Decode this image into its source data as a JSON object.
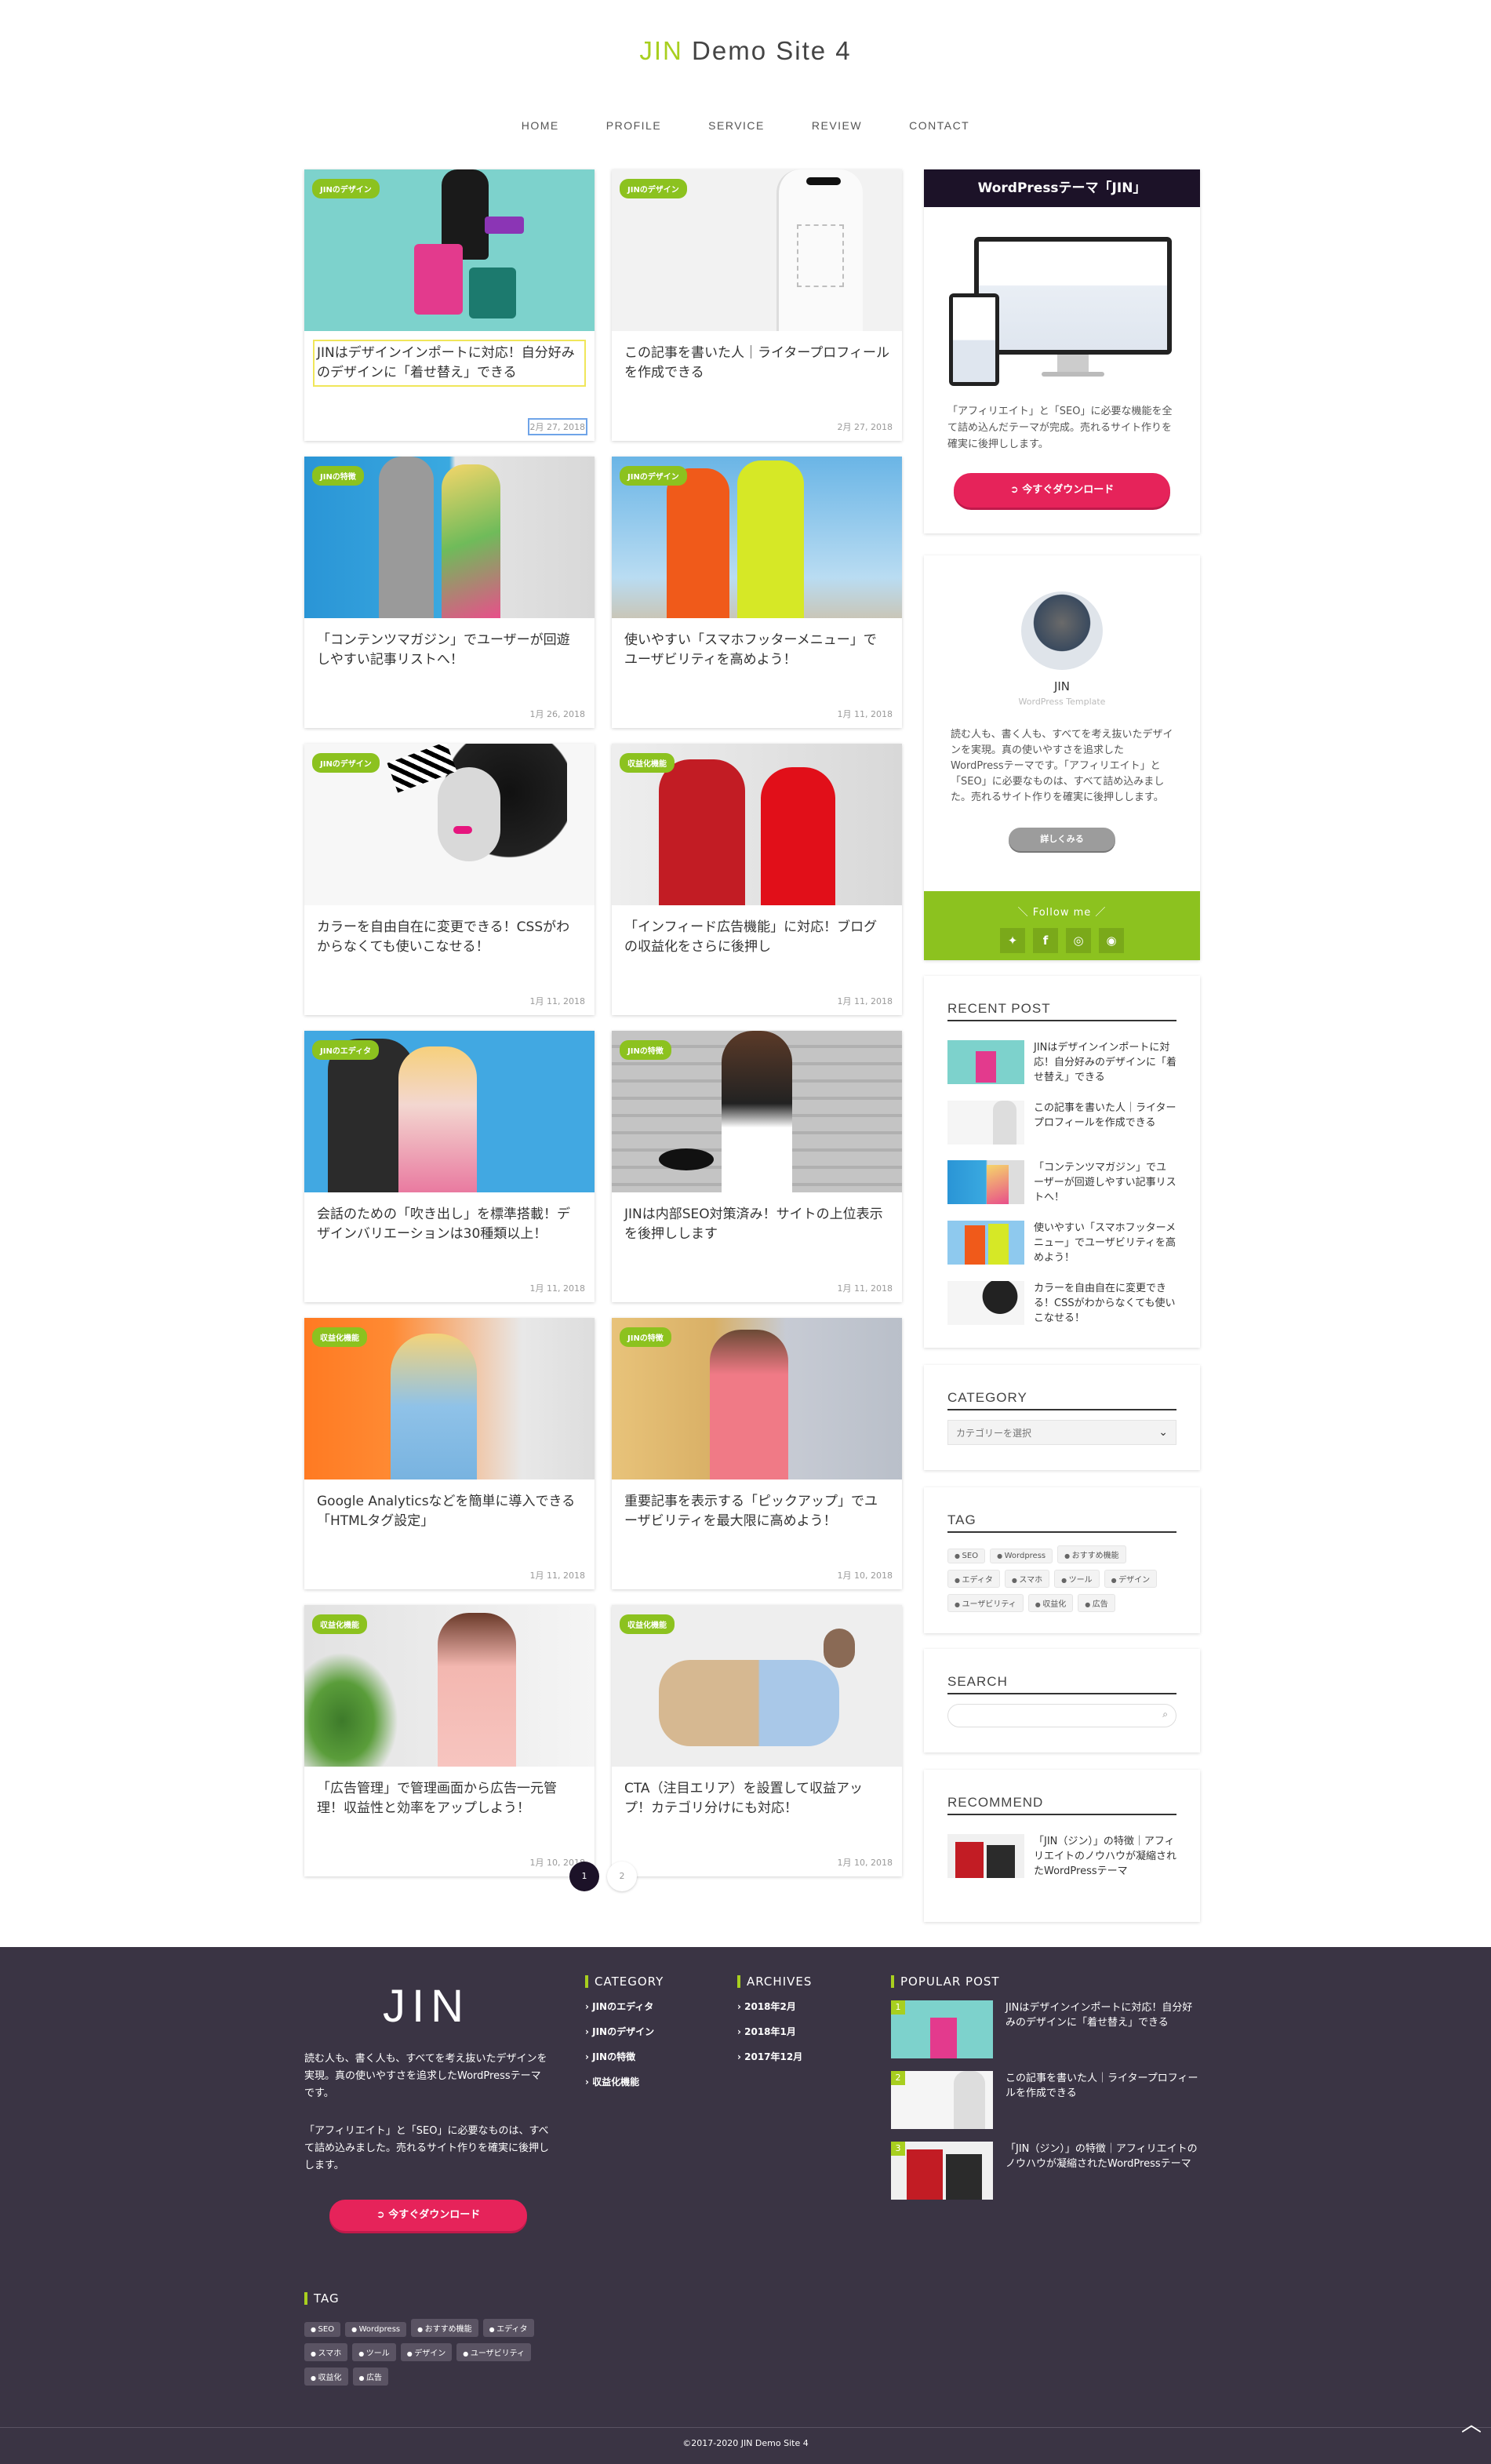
{
  "site": {
    "title_brand": "JIN",
    "title_rest": " Demo Site 4"
  },
  "nav": [
    "HOME",
    "PROFILE",
    "SERVICE",
    "REVIEW",
    "CONTACT"
  ],
  "posts": [
    {
      "category": "JINのデザイン",
      "title": "JINはデザインインポートに対応！自分好みのデザインに「着せ替え」できる",
      "date": "2月 27, 2018"
    },
    {
      "category": "JINのデザイン",
      "title": "この記事を書いた人｜ライタープロフィールを作成できる",
      "date": "2月 27, 2018"
    },
    {
      "category": "JINの特徴",
      "title": "「コンテンツマガジン」でユーザーが回遊しやすい記事リストへ！",
      "date": "1月 26, 2018"
    },
    {
      "category": "JINのデザイン",
      "title": "使いやすい「スマホフッターメニュー」でユーザビリティを高めよう！",
      "date": "1月 11, 2018"
    },
    {
      "category": "JINのデザイン",
      "title": "カラーを自由自在に変更できる！CSSがわからなくても使いこなせる！",
      "date": "1月 11, 2018"
    },
    {
      "category": "収益化機能",
      "title": "「インフィード広告機能」に対応！ブログの収益化をさらに後押し",
      "date": "1月 11, 2018"
    },
    {
      "category": "JINのエディタ",
      "title": "会話のための「吹き出し」を標準搭載！デザインバリエーションは30種類以上！",
      "date": "1月 11, 2018"
    },
    {
      "category": "JINの特徴",
      "title": "JINは内部SEO対策済み！サイトの上位表示を後押しします",
      "date": "1月 11, 2018"
    },
    {
      "category": "収益化機能",
      "title": "Google Analyticsなどを簡単に導入できる「HTMLタグ設定」",
      "date": "1月 11, 2018"
    },
    {
      "category": "JINの特徴",
      "title": "重要記事を表示する「ピックアップ」でユーザビリティを最大限に高めよう！",
      "date": "1月 10, 2018"
    },
    {
      "category": "収益化機能",
      "title": "「広告管理」で管理画面から広告一元管理！収益性と効率をアップしよう！",
      "date": "1月 10, 2018"
    },
    {
      "category": "収益化機能",
      "title": "CTA（注目エリア）を設置して収益アップ！カテゴリ分けにも対応！",
      "date": "1月 10, 2018"
    }
  ],
  "pagination": {
    "current": "1",
    "next": "2"
  },
  "ad_widget": {
    "heading": "WordPressテーマ「JIN」",
    "text": "「アフィリエイト」と「SEO」に必要な機能を全て詰め込んだテーマが完成。売れるサイト作りを確実に後押しします。",
    "button": "今すぐダウンロード"
  },
  "profile": {
    "name": "JIN",
    "subtitle": "WordPress Template",
    "text": "読む人も、書く人も、すべてを考え抜いたデザインを実現。真の使いやすさを追求したWordPressテーマです。「アフィリエイト」と「SEO」に必要なものは、すべて詰め込みました。売れるサイト作りを確実に後押しします。",
    "button": "詳しくみる",
    "follow": "＼ Follow me ／"
  },
  "recent": {
    "title": "RECENT POST",
    "items": [
      "JINはデザインインポートに対応！自分好みのデザインに「着せ替え」できる",
      "この記事を書いた人｜ライタープロフィールを作成できる",
      "「コンテンツマガジン」でユーザーが回遊しやすい記事リストへ！",
      "使いやすい「スマホフッターメニュー」でユーザビリティを高めよう！",
      "カラーを自由自在に変更できる！CSSがわからなくても使いこなせる！"
    ]
  },
  "category_widget": {
    "title": "CATEGORY",
    "select": "カテゴリーを選択"
  },
  "tag_widget": {
    "title": "TAG",
    "tags": [
      "SEO",
      "Wordpress",
      "おすすめ機能",
      "エディタ",
      "スマホ",
      "ツール",
      "デザイン",
      "ユーザビリティ",
      "収益化",
      "広告"
    ]
  },
  "search_widget": {
    "title": "SEARCH"
  },
  "recommend": {
    "title": "RECOMMEND",
    "text": "「JIN（ジン）」の特徴｜アフィリエイトのノウハウが凝縮されたWordPressテーマ"
  },
  "footer": {
    "logo": "JIN",
    "text1": "読む人も、書く人も、すべてを考え抜いたデザインを実現。真の使いやすさを追求したWordPressテーマです。",
    "text2": "「アフィリエイト」と「SEO」に必要なものは、すべて詰め込みました。売れるサイト作りを確実に後押しします。",
    "button": "今すぐダウンロード",
    "category_title": "CATEGORY",
    "categories": [
      "JINのエディタ",
      "JINのデザイン",
      "JINの特徴",
      "収益化機能"
    ],
    "archives_title": "ARCHIVES",
    "archives": [
      "2018年2月",
      "2018年1月",
      "2017年12月"
    ],
    "popular_title": "POPULAR POST",
    "popular": [
      {
        "num": "1",
        "title": "JINはデザインインポートに対応！自分好みのデザインに「着せ替え」できる"
      },
      {
        "num": "2",
        "title": "この記事を書いた人｜ライタープロフィールを作成できる"
      },
      {
        "num": "3",
        "title": "「JIN（ジン）」の特徴｜アフィリエイトのノウハウが凝縮されたWordPressテーマ"
      }
    ],
    "tag_title": "TAG",
    "tags": [
      "SEO",
      "Wordpress",
      "おすすめ機能",
      "エディタ",
      "スマホ",
      "ツール",
      "デザイン",
      "ユーザビリティ",
      "収益化",
      "広告"
    ],
    "copyright": "©2017-2020 JIN Demo Site 4"
  },
  "colors": {
    "accent": "#a8cf1f",
    "pink": "#e6235a",
    "footer_bg": "#3a3444",
    "ad_header": "#1c1228"
  }
}
